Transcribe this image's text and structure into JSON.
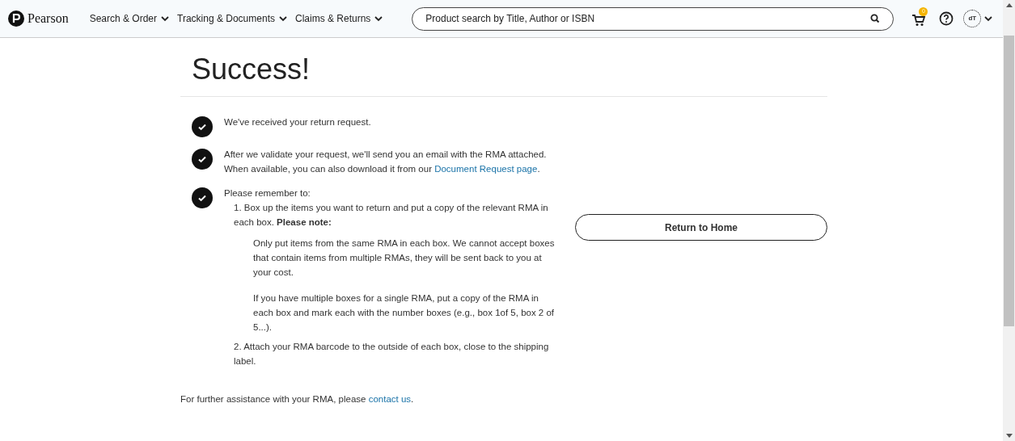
{
  "header": {
    "logo": "Pearson",
    "nav": [
      {
        "label": "Search & Order"
      },
      {
        "label": "Tracking & Documents"
      },
      {
        "label": "Claims & Returns"
      }
    ],
    "search": {
      "placeholder": "Product search by Title, Author or ISBN"
    },
    "cart_badge": "0",
    "avatar": "dT"
  },
  "title": "Success!",
  "steps": [
    {
      "text": "We've received your return request."
    },
    {
      "text": "After we validate your request, we'll send you an email with the RMA attached. When available, you can also download it from our ",
      "link": "Document Request page",
      "after": "."
    },
    {
      "text": "Please remember to:",
      "items": [
        {
          "text": "1. Box up the items you want to return and put a copy of the relevant RMA in each box. **Please note:**",
          "notes": [
            "Only put items from the same RMA in each box. We cannot accept boxes that contain items from multiple RMAs, they will be sent back to you at your cost.",
            "If you have multiple boxes for a single RMA, put a copy of the RMA in each box and mark each with the number boxes (e.g., box 1of 5, box 2 of 5...)."
          ]
        },
        {
          "text": "2. Attach your RMA barcode to the outside of each box, close to the shipping label."
        }
      ]
    }
  ],
  "footer": {
    "text": "For further assistance with your RMA, please ",
    "link": "contact us",
    "after": "."
  },
  "button": "Return to Home"
}
